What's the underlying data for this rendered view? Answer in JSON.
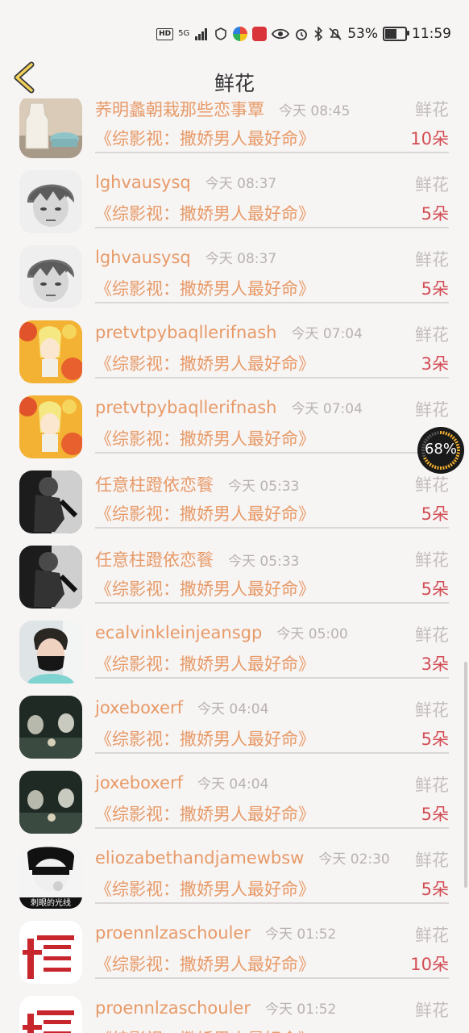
{
  "status_bar": {
    "hd": "HD",
    "network": "5G",
    "battery": "53%",
    "time": "11:59"
  },
  "header": {
    "title": "鲜花"
  },
  "float_widget": {
    "value": "68%",
    "level": 0.68
  },
  "items": [
    {
      "name": "荞明蠡朝栽那些恋事覃",
      "time": "今天 08:45",
      "type": "鲜花",
      "book": "《综影视：撒娇男人最好命》",
      "count": "10朵",
      "avatar": "avatar-milk"
    },
    {
      "name": "lghvausysq",
      "time": "今天 08:37",
      "type": "鲜花",
      "book": "《综影视：撒娇男人最好命》",
      "count": "5朵",
      "avatar": "avatar-sketch"
    },
    {
      "name": "lghvausysq",
      "time": "今天 08:37",
      "type": "鲜花",
      "book": "《综影视：撒娇男人最好命》",
      "count": "5朵",
      "avatar": "avatar-sketch"
    },
    {
      "name": "pretvtpybaqllerifnash",
      "time": "今天 07:04",
      "type": "鲜花",
      "book": "《综影视：撒娇男人最好命》",
      "count": "3朵",
      "avatar": "avatar-flower"
    },
    {
      "name": "pretvtpybaqllerifnash",
      "time": "今天 07:04",
      "type": "鲜花",
      "book": "《综影视：撒娇男人最好命》",
      "count": "",
      "avatar": "avatar-flower"
    },
    {
      "name": "任意柱蹬依恋餮",
      "time": "今天 05:33",
      "type": "鲜花",
      "book": "《综影视：撒娇男人最好命》",
      "count": "5朵",
      "avatar": "avatar-bw"
    },
    {
      "name": "任意柱蹬依恋餮",
      "time": "今天 05:33",
      "type": "鲜花",
      "book": "《综影视：撒娇男人最好命》",
      "count": "5朵",
      "avatar": "avatar-bw"
    },
    {
      "name": "ecalvinkleinjeansgp",
      "time": "今天 05:00",
      "type": "鲜花",
      "book": "《综影视：撒娇男人最好命》",
      "count": "3朵",
      "avatar": "avatar-mask"
    },
    {
      "name": "joxeboxerf",
      "time": "今天 04:04",
      "type": "鲜花",
      "book": "《综影视：撒娇男人最好命》",
      "count": "5朵",
      "avatar": "avatar-dark"
    },
    {
      "name": "joxeboxerf",
      "time": "今天 04:04",
      "type": "鲜花",
      "book": "《综影视：撒娇男人最好命》",
      "count": "5朵",
      "avatar": "avatar-dark"
    },
    {
      "name": "eliozabethandjamewbsw",
      "time": "今天 02:30",
      "type": "鲜花",
      "book": "《综影视：撒娇男人最好命》",
      "count": "5朵",
      "avatar": "avatar-smoke",
      "avatar_caption": "刺眼的光线"
    },
    {
      "name": "proennlzaschouler",
      "time": "今天 01:52",
      "type": "鲜花",
      "book": "《综影视：撒娇男人最好命》",
      "count": "10朵",
      "avatar": "avatar-red-text"
    },
    {
      "name": "proennlzaschouler",
      "time": "今天 01:52",
      "type": "鲜花",
      "book": "《综影视：撒娇男人最好命》",
      "count": "",
      "avatar": "avatar-red-text"
    }
  ]
}
